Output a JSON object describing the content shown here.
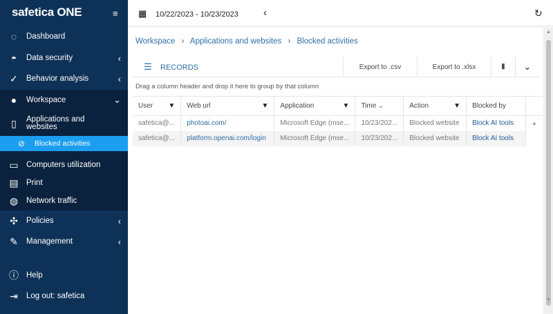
{
  "sidebar": {
    "logo": "safetica ONE",
    "items": [
      {
        "label": "Dashboard"
      },
      {
        "label": "Data security"
      },
      {
        "label": "Behavior analysis"
      },
      {
        "label": "Workspace"
      },
      {
        "label": "Applications and websites"
      },
      {
        "label": "Blocked activities"
      },
      {
        "label": "Computers utilization"
      },
      {
        "label": "Print"
      },
      {
        "label": "Network traffic"
      },
      {
        "label": "Policies"
      },
      {
        "label": "Management"
      },
      {
        "label": "Help"
      },
      {
        "label": "Log out: safetica"
      }
    ]
  },
  "topbar": {
    "date_range": "10/22/2023 - 10/23/2023"
  },
  "breadcrumb": [
    "Workspace",
    "Applications and websites",
    "Blocked activities"
  ],
  "toolbar": {
    "title": "RECORDS",
    "export_csv": "Export to .csv",
    "export_xlsx": "Export to .xlsx"
  },
  "group_hint": "Drag a column header and drop it here to group by that column",
  "table": {
    "columns": [
      "User",
      "Web url",
      "Application",
      "Time",
      "Action",
      "Blocked by"
    ],
    "rows": [
      [
        "safetica@...",
        "photoai.com/",
        "Microsoft Edge (mse...",
        "10/23/202...",
        "Blocked website",
        "Block AI tools"
      ],
      [
        "safetica@...",
        "platform.openai.com/login",
        "Microsoft Edge (mse...",
        "10/23/202...",
        "Blocked website",
        "Block AI tools"
      ]
    ]
  }
}
